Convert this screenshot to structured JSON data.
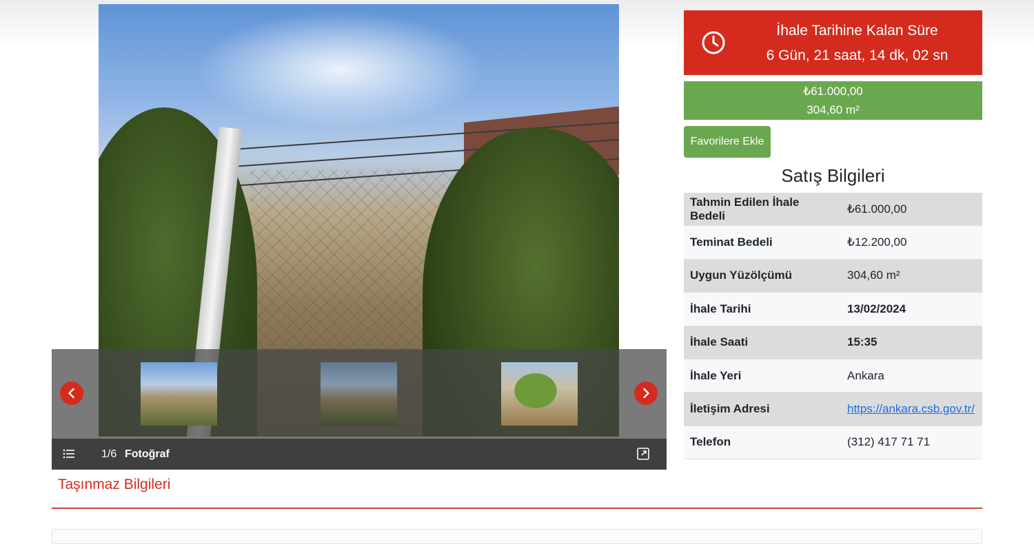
{
  "gallery": {
    "counter": "1/6",
    "caption": "Fotoğraf",
    "thumbnails": [
      "fence-with-post",
      "fence-and-shrubs",
      "young-pine-tree"
    ]
  },
  "countdown": {
    "title": "İhale Tarihine Kalan Süre",
    "value": "6 Gün, 21 saat, 14 dk, 02 sn"
  },
  "price": {
    "amount": "₺61.000,00",
    "area": "304,60 m²"
  },
  "favorite_button": "Favorilere Ekle",
  "sales_info": {
    "title": "Satış Bilgileri",
    "rows": [
      {
        "label": "Tahmin Edilen İhale Bedeli",
        "value": "₺61.000,00"
      },
      {
        "label": "Teminat Bedeli",
        "value": "₺12.200,00"
      },
      {
        "label": "Uygun Yüzölçümü",
        "value": "304,60 m²"
      },
      {
        "label": "İhale Tarihi",
        "value": "13/02/2024"
      },
      {
        "label": "İhale Saati",
        "value": "15:35"
      },
      {
        "label": "İhale Yeri",
        "value": "Ankara"
      },
      {
        "label": "İletişim Adresi",
        "value": "https://ankara.csb.gov.tr/"
      },
      {
        "label": "Telefon",
        "value": "(312) 417 71 71"
      }
    ]
  },
  "property_section": {
    "title": "Taşınmaz Bilgileri"
  },
  "colors": {
    "accent_red": "#d52b1e",
    "accent_green": "#6aa84f",
    "link_blue": "#1a6fe0"
  },
  "icons": {
    "countdown": "clock-icon",
    "prev": "chevron-left-icon",
    "next": "chevron-right-icon",
    "list": "list-icon",
    "fullscreen": "expand-icon"
  }
}
